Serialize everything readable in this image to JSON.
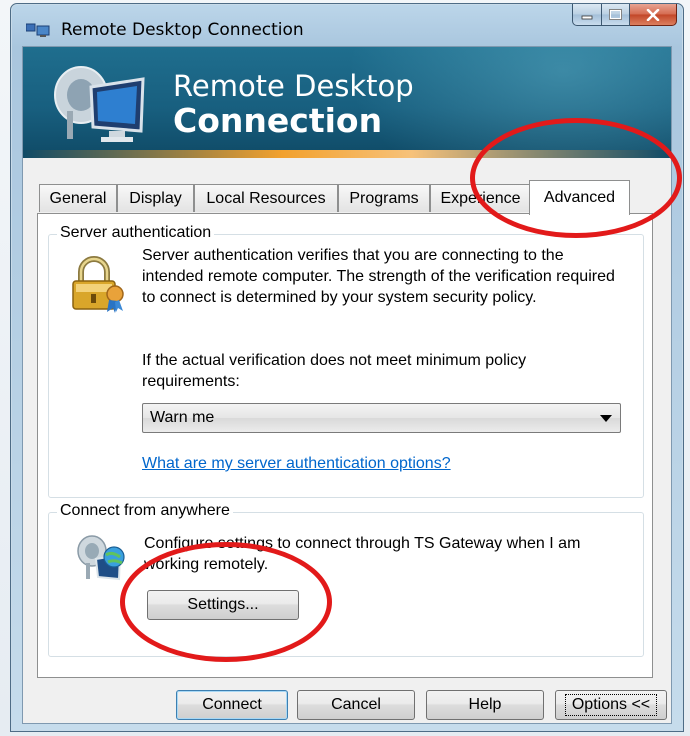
{
  "window": {
    "title": "Remote Desktop Connection",
    "controls": {
      "minimize": "minimize",
      "maximize": "maximize",
      "close": "close"
    }
  },
  "banner": {
    "line1": "Remote Desktop",
    "line2": "Connection",
    "icon": "remote-desktop-monitor-icon"
  },
  "tabs": [
    {
      "label": "General",
      "active": false
    },
    {
      "label": "Display",
      "active": false
    },
    {
      "label": "Local Resources",
      "active": false
    },
    {
      "label": "Programs",
      "active": false
    },
    {
      "label": "Experience",
      "active": false
    },
    {
      "label": "Advanced",
      "active": true
    }
  ],
  "server_auth": {
    "group_title": "Server authentication",
    "icon": "lock-certificate-icon",
    "description": "Server authentication verifies that you are connecting to the intended remote computer. The strength of the verification required to connect is determined by your system security policy.",
    "policy_prompt": "If the actual verification does not meet minimum policy requirements:",
    "selected_option": "Warn me",
    "help_link": "What are my server authentication options?"
  },
  "connect_anywhere": {
    "group_title": "Connect from anywhere",
    "icon": "ts-gateway-globe-icon",
    "description": "Configure settings to connect through TS Gateway when I am working remotely.",
    "settings_button": "Settings..."
  },
  "footer": {
    "connect": "Connect",
    "cancel": "Cancel",
    "help": "Help",
    "options": "Options <<"
  },
  "annotations": {
    "highlight_color": "#e21a1a"
  }
}
